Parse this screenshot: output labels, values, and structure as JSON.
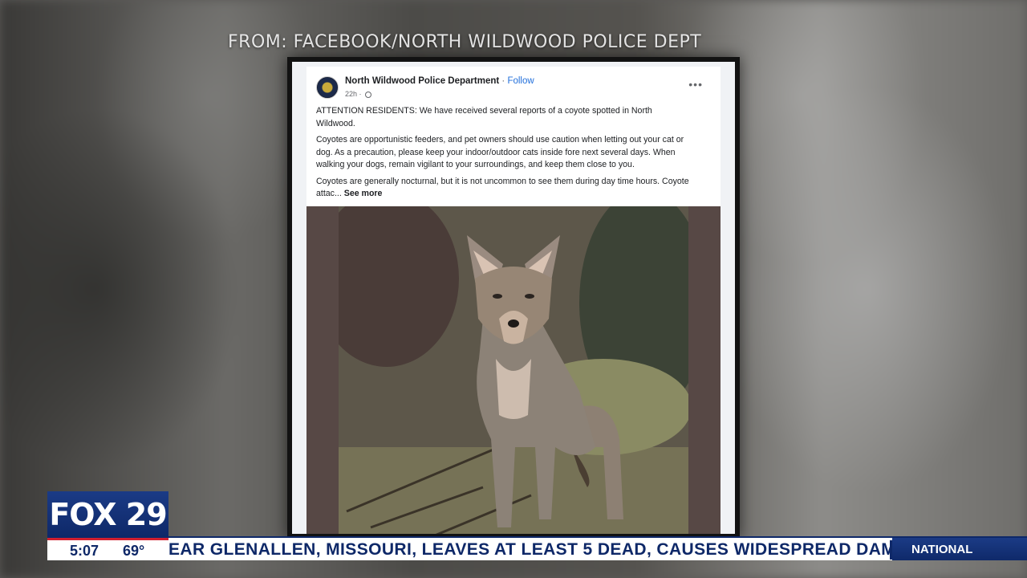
{
  "source_caption": "FROM: FACEBOOK/NORTH WILDWOOD POLICE DEPT",
  "post": {
    "page_name": "North Wildwood Police Department",
    "separator": " · ",
    "follow_label": "Follow",
    "time": "22h · ",
    "more_label": "•••",
    "paragraphs": [
      "ATTENTION RESIDENTS:  We have received several reports of a coyote spotted in North Wildwood.",
      "Coyotes are opportunistic feeders, and pet owners should use caution when letting out your cat or dog.  As a precaution, please keep your indoor/outdoor cats inside fore next several days.  When walking your dogs, remain vigilant to your surroundings, and keep them close to you.",
      "Coyotes are generally nocturnal, but it is not uncommon to see them during day time hours. Coyote attac..."
    ],
    "see_more_label": "See more"
  },
  "broadcast": {
    "logo_text": "FOX 29",
    "time": "5:07",
    "temperature": "69°",
    "ticker_text": "EAR GLENALLEN, MISSOURI, LEAVES AT LEAST 5 DEAD, CAUSES WIDESPREAD DAM",
    "ticker_category": "NATIONAL"
  },
  "colors": {
    "brand_blue": "#0e2868",
    "brand_red": "#d21f2f",
    "facebook_link": "#216fdb"
  }
}
